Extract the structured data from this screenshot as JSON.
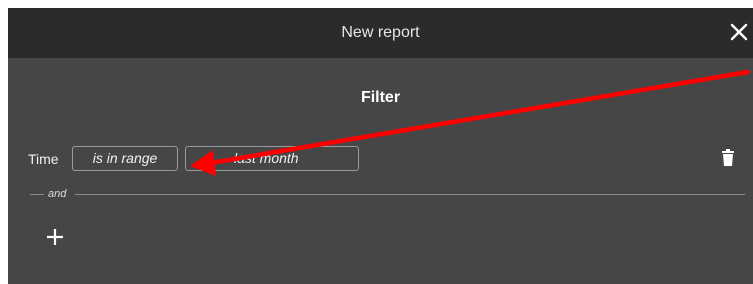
{
  "dialog": {
    "title": "New report",
    "close_icon": "close-icon"
  },
  "filter": {
    "heading": "Filter",
    "rows": [
      {
        "field": "Time",
        "operator": "is in range",
        "value": "last month",
        "delete_icon": "trash-icon"
      }
    ],
    "conjunction": "and",
    "add_icon": "plus-icon"
  },
  "annotation": {
    "color": "#ff0000",
    "icon": "red-arrow-annotation"
  },
  "colors": {
    "titlebar": "#2b2b2b",
    "body": "#464646",
    "text": "#f0f0f0"
  }
}
